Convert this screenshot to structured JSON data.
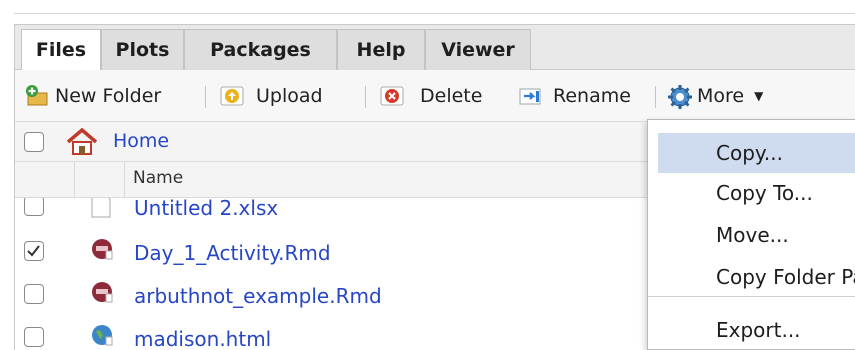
{
  "tabs": [
    "Files",
    "Plots",
    "Packages",
    "Help",
    "Viewer"
  ],
  "toolbar": {
    "new_folder": "New Folder",
    "upload": "Upload",
    "delete": "Delete",
    "rename": "Rename",
    "more": "More"
  },
  "path": {
    "home": "Home"
  },
  "columns": {
    "name": "Name"
  },
  "files": [
    {
      "name": "Untitled 2.xlsx",
      "checked": false,
      "icon": "blank-file-icon"
    },
    {
      "name": "Day_1_Activity.Rmd",
      "checked": true,
      "icon": "rmarkdown-icon"
    },
    {
      "name": "arbuthnot_example.Rmd",
      "checked": false,
      "icon": "rmarkdown-icon"
    },
    {
      "name": "madison.html",
      "checked": false,
      "icon": "html-globe-icon"
    }
  ],
  "more_menu": {
    "items": [
      "Copy...",
      "Copy To...",
      "Move...",
      "Copy Folder Path to Clipboard",
      "Export..."
    ],
    "highlighted": "Copy..."
  },
  "colors": {
    "link": "#2746c6",
    "highlight": "#cfdcf0"
  }
}
